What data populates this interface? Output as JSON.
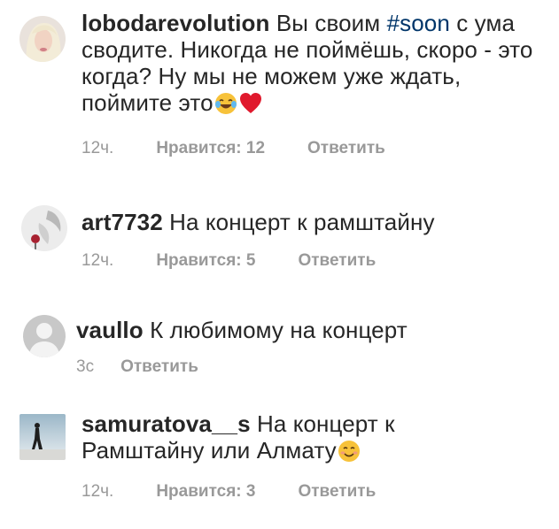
{
  "comments": [
    {
      "username": "lobodarevolution",
      "text_1": "Вы своим ",
      "hashtag": "#soon",
      "text_2": " с ума сводите. Никогда не поймёшь, скоро - это когда? Ну мы не можем уже ждать, поймите это",
      "emojis": [
        "tears-of-joy-emoji",
        "red-heart-emoji"
      ],
      "time": "12ч.",
      "likes": "Нравится: 12",
      "reply": "Ответить"
    },
    {
      "username": "art7732",
      "text": "На концерт к рамштайну",
      "time": "12ч.",
      "likes": "Нравится: 5",
      "reply": "Ответить"
    },
    {
      "username": "vaullo",
      "text": "К любимому на концерт",
      "time": "3с",
      "reply": "Ответить"
    },
    {
      "username": "samuratova__s",
      "text": "На концерт к Рамштайну или Алмату",
      "emojis": [
        "smiling-face-emoji"
      ],
      "time": "12ч.",
      "likes": "Нравится: 3",
      "reply": "Ответить"
    }
  ]
}
